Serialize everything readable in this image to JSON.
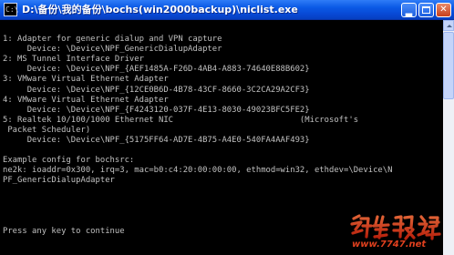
{
  "window": {
    "title": "D:\\备份\\我的备份\\bochs(win2000backup)\\niclist.exe",
    "icon_name": "console-app-icon",
    "icon_glyph": "C:\\",
    "buttons": {
      "minimize": "minimize-icon",
      "maximize": "maximize-icon",
      "close": "close-icon",
      "close_glyph": "✕"
    }
  },
  "console": {
    "lines": [
      "",
      "1: Adapter for generic dialup and VPN capture",
      "     Device: \\Device\\NPF_GenericDialupAdapter",
      "2: MS Tunnel Interface Driver",
      "     Device: \\Device\\NPF_{AEF1485A-F26D-4AB4-A883-74640E88B602}",
      "3: VMware Virtual Ethernet Adapter",
      "     Device: \\Device\\NPF_{12CE0B6D-4B78-43CF-8660-3C2CA29A2CF3}",
      "4: VMware Virtual Ethernet Adapter",
      "     Device: \\Device\\NPF_{F4243120-037F-4E13-8030-49023BFC5FE2}",
      "5: Realtek 10/100/1000 Ethernet NIC                          (Microsoft's",
      " Packet Scheduler)",
      "     Device: \\Device\\NPF_{5175FF64-AD7E-4B75-A4E0-540FA4AAF493}",
      "",
      "Example config for bochsrc:",
      "ne2k: ioaddr=0x300, irq=3, mac=b0:c4:20:00:00:00, ethmod=win32, ethdev=\\Device\\N",
      "PF_GenericDialupAdapter",
      "",
      "",
      "",
      "",
      "Press any key to continue"
    ]
  },
  "watermark": {
    "logo_text": "红黑联盟",
    "url": "www.7747.net",
    "color": "#e0401e"
  },
  "colors": {
    "console_text": "#c0c0c0",
    "console_background": "#000000",
    "titlebar": "#0a59e5",
    "title_text": "#ffffff"
  }
}
